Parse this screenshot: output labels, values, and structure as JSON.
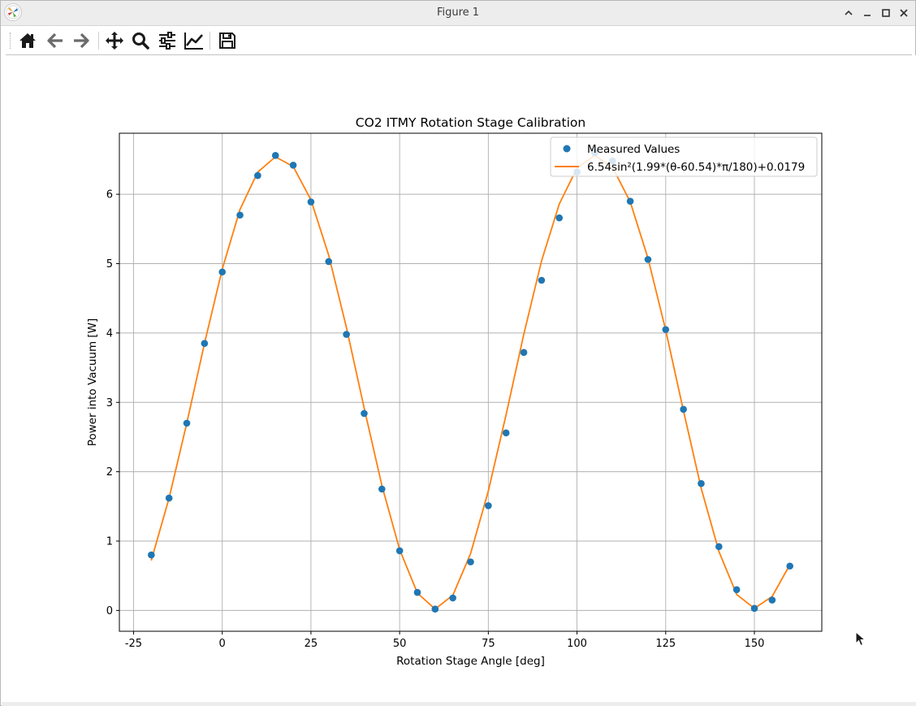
{
  "window": {
    "title": "Figure 1",
    "controls": [
      "chevron-up-icon",
      "minimize-icon",
      "maximize-icon",
      "close-icon"
    ]
  },
  "toolbar": {
    "buttons": [
      {
        "name": "home",
        "icon": "home-icon"
      },
      {
        "name": "back",
        "icon": "arrow-left-icon"
      },
      {
        "name": "forward",
        "icon": "arrow-right-icon"
      },
      {
        "name": "pan",
        "icon": "move-icon"
      },
      {
        "name": "zoom",
        "icon": "magnifier-icon"
      },
      {
        "name": "subplots",
        "icon": "sliders-icon"
      },
      {
        "name": "edit-axes",
        "icon": "line-chart-icon"
      },
      {
        "name": "save",
        "icon": "floppy-disk-icon"
      }
    ]
  },
  "colors": {
    "measured": "#1f77b4",
    "fit": "#ff7f0e",
    "grid": "#b0b0b0"
  },
  "chart_data": {
    "type": "scatter",
    "title": "CO2 ITMY Rotation Stage Calibration",
    "xlabel": "Rotation Stage Angle [deg]",
    "ylabel": "Power into Vacuum [W]",
    "xlim": [
      -29,
      169
    ],
    "ylim": [
      -0.3,
      6.88
    ],
    "xticks": [
      -25,
      0,
      25,
      50,
      75,
      100,
      125,
      150
    ],
    "yticks": [
      0,
      1,
      2,
      3,
      4,
      5,
      6
    ],
    "grid": true,
    "legend_position": "upper right",
    "series": [
      {
        "name": "Measured Values",
        "kind": "scatter",
        "color": "#1f77b4",
        "x": [
          -20,
          -15,
          -10,
          -5,
          0,
          5,
          10,
          15,
          20,
          25,
          30,
          35,
          40,
          45,
          50,
          55,
          60,
          65,
          70,
          75,
          80,
          85,
          90,
          95,
          100,
          105,
          110,
          115,
          120,
          125,
          130,
          135,
          140,
          145,
          150,
          155,
          160
        ],
        "y": [
          0.8,
          1.62,
          2.7,
          3.85,
          4.88,
          5.7,
          6.27,
          6.56,
          6.42,
          5.89,
          5.03,
          3.98,
          2.84,
          1.75,
          0.86,
          0.26,
          0.02,
          0.18,
          0.7,
          1.51,
          2.56,
          3.72,
          4.76,
          5.66,
          6.32,
          6.6,
          6.48,
          5.9,
          5.06,
          4.05,
          2.9,
          1.83,
          0.92,
          0.3,
          0.03,
          0.15,
          0.64
        ]
      },
      {
        "name": "6.54sin²(1.99*(θ-60.54)*π/180)+0.0179",
        "kind": "line",
        "color": "#ff7f0e",
        "x": [
          -20,
          -15,
          -10,
          -5,
          0,
          5,
          10,
          15,
          20,
          25,
          30,
          35,
          40,
          45,
          50,
          55,
          60,
          65,
          70,
          75,
          80,
          85,
          90,
          95,
          100,
          105,
          110,
          115,
          120,
          125,
          130,
          135,
          140,
          145,
          150,
          155,
          160
        ],
        "y": [
          0.72,
          1.62,
          2.7,
          3.85,
          4.92,
          5.78,
          6.32,
          6.54,
          6.4,
          5.92,
          5.12,
          4.08,
          2.92,
          1.8,
          0.88,
          0.25,
          0.02,
          0.22,
          0.82,
          1.72,
          2.82,
          3.98,
          5.04,
          5.86,
          6.38,
          6.56,
          6.39,
          5.89,
          5.08,
          4.04,
          2.88,
          1.76,
          0.85,
          0.23,
          0.03,
          0.2,
          0.66
        ]
      }
    ]
  }
}
